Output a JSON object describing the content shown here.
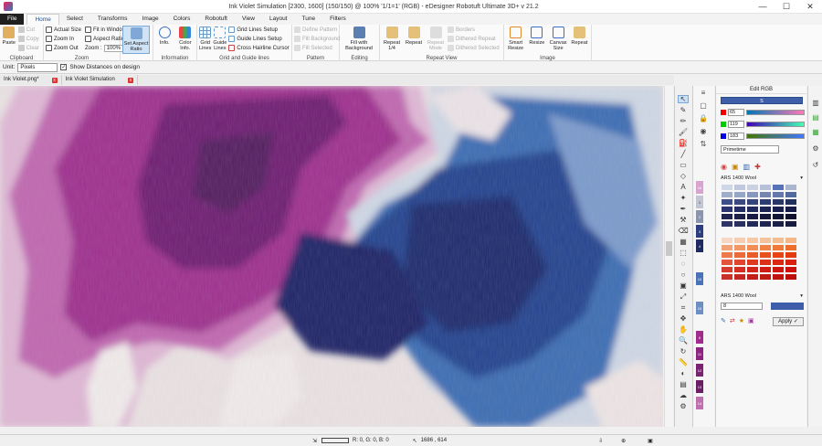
{
  "window": {
    "title": "Ink Violet Simulation [2300, 1600] (150/150) @ 100% '1/1=1' (RGB) - eDesigner Robotuft Ultimate 3D+ v 21.2",
    "minimize": "—",
    "maximize": "☐",
    "close": "✕"
  },
  "menu": {
    "tabs": [
      "File",
      "Home",
      "Select",
      "Transforms",
      "Image",
      "Colors",
      "Robotuft",
      "View",
      "Layout",
      "Tune",
      "Filters"
    ],
    "active": "Home"
  },
  "ribbon": {
    "clipboard": {
      "paste": "Paste",
      "cut": "Cut",
      "copy": "Copy",
      "clear": "Clear",
      "label": "Clipboard"
    },
    "zoom": {
      "actual_size": "Actual Size",
      "zoom_in": "Zoom In",
      "zoom_out": "Zoom Out",
      "fit_in_window": "Fit in Window",
      "aspect_ratio": "Aspect Ratio",
      "zoom_label": "Zoom :",
      "zoom_value": "100%",
      "label": "Zoom"
    },
    "aspect": {
      "set_aspect_ratio": "Set Aspect Ratio"
    },
    "information": {
      "info": "Info.",
      "color_info": "Color Info.",
      "label": "Information"
    },
    "grid": {
      "grid_lines": "Grid Lines",
      "guide_lines": "Guide Lines",
      "grid_setup": "Grid Lines Setup",
      "guide_setup": "Guide Lines Setup",
      "cross_hairline": "Cross Hairline Cursor",
      "label": "Grid and Guide lines"
    },
    "pattern": {
      "define": "Define Pattern",
      "fill_bg": "Fill Background",
      "fill_selected": "Fill Selected",
      "label": "Pattern"
    },
    "editing": {
      "fill_with_bg": "Fill with Background",
      "label": "Editing"
    },
    "repeat_view": {
      "repeat_14": "Repeat 1/4",
      "repeat": "Repeat",
      "repeat_mode": "Repeat Mode",
      "borders": "Borders",
      "dithered_repeat": "Dithered Repeat",
      "dithered_selected": "Dithered Selected",
      "label": "Repeat View"
    },
    "image": {
      "smart_resize": "Smart Resize",
      "resize": "Resize",
      "canvas_size": "Canvas Size",
      "repeat": "Repeat",
      "label": "Image"
    }
  },
  "options": {
    "unit_label": "Unit:",
    "unit_value": "Pixels",
    "show_distances": "Show Distances on design",
    "checked": "✓"
  },
  "documents": {
    "tabs": [
      "Ink Violet.png*",
      "Ink Violet Simulation"
    ]
  },
  "color_panel": {
    "title": "Edit RGB",
    "current": "S",
    "r": "65",
    "g": "119",
    "b": "183",
    "library": "Primetime",
    "palette_name": "ARS 1400 Wool",
    "palette_name2": "ARS 1400 Wool",
    "swatch_count": "8",
    "apply": "Apply ✓"
  },
  "side_numbers": [
    "16",
    "1",
    "2",
    "3",
    "4",
    "10",
    "15",
    "6",
    "11",
    "12",
    "13",
    "14"
  ],
  "status": {
    "pos1": "R: 0, G: 0, B: 0",
    "pos2": "1686 , 614"
  },
  "colors": {
    "accent": "#3f5ea9",
    "magenta": "#a0308f",
    "blue": "#2e5aa6"
  }
}
